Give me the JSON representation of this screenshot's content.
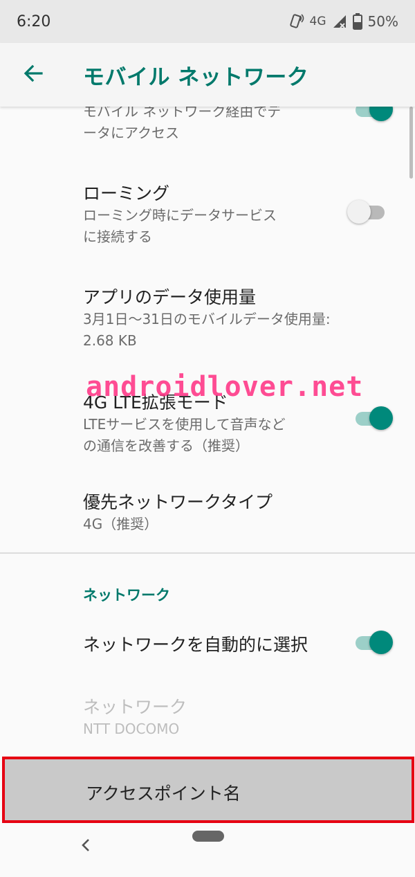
{
  "status_bar": {
    "time": "6:20",
    "network": "4G",
    "battery": "50%"
  },
  "app_bar": {
    "title": "モバイル ネットワーク"
  },
  "items": {
    "mobile_data": {
      "subtitle_lines": [
        "モバイル ネットワーク経由でデ",
        "ータにアクセス"
      ],
      "toggle": "on"
    },
    "roaming": {
      "title": "ローミング",
      "subtitle_lines": [
        "ローミング時にデータサービス",
        "に接続する"
      ],
      "toggle": "off"
    },
    "app_data_usage": {
      "title": "アプリのデータ使用量",
      "subtitle_lines": [
        "3月1日～31日のモバイルデータ使用量:",
        "2.68 KB"
      ]
    },
    "lte_enhanced": {
      "title": "4G LTE拡張モード",
      "subtitle_lines": [
        "LTEサービスを使用して音声など",
        "の通信を改善する（推奨）"
      ],
      "toggle": "on"
    },
    "preferred_network": {
      "title": "優先ネットワークタイプ",
      "subtitle": "4G（推奨）"
    }
  },
  "network_section": {
    "header": "ネットワーク",
    "auto_select": {
      "title": "ネットワークを自動的に選択",
      "toggle": "on"
    },
    "network": {
      "title": "ネットワーク",
      "subtitle": "NTT DOCOMO"
    },
    "apn": {
      "title": "アクセスポイント名"
    }
  },
  "watermark": "androidlover.net",
  "colors": {
    "accent": "#00796b",
    "toggle_on": "#00897b",
    "highlight_border": "#e60012"
  }
}
